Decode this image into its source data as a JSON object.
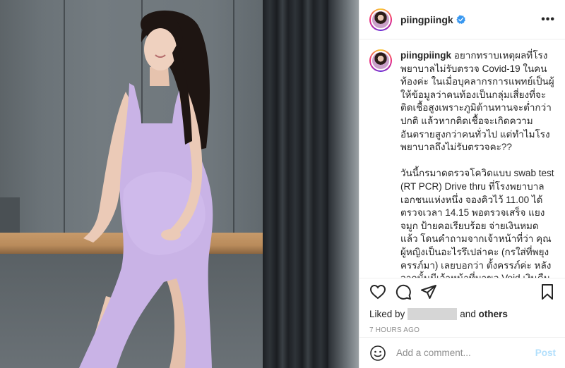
{
  "post": {
    "username": "piingpiingk",
    "more_icon": "more-horizontal-icon",
    "verified_icon": "verified-badge-icon",
    "caption": "อยากทราบเหตุผลที่โรงพยาบาลไม่รับตรวจ Covid-19 ในคนท้องค่ะ ในเมื่อบุคลากรการแพทย์เป็นผู้ให้ข้อมูลว่าคนท้องเป็นกลุ่มเสี่ยงที่จะติดเชื้อสูงเพราะภูมิต้านทานจะต่ำกว่าปกติ แล้วหากติดเชื้อจะเกิดความอันตรายสูงกว่าคนทั่วไป แต่ทำไมโรงพยาบาลถึงไม่รับตรวจคะ??\n\nวันนี้กรมาดตรวจโควิดแบบ swab test (RT PCR) Drive thru ที่โรงพยาบาลเอกชนแห่งหนึ่ง จองคิวไว้ 11.00 ได้ตรวจเวลา 14.15 พอตรวจเสร็จ แยงจมูก ป้ายคอเรียบร้อย จ่ายเงินหมดแล้ว โดนคำถามจากเจ้าหน้าที่ว่า คุณผู้หญิงเป็นอะไรรึเปล่าคะ (กรใส่ที่พยุงครรภ์มา) เลยบอกว่า ตั้งครรภ์ค่ะ หลังจากนั้นมีเจ้าหน้าที่มาขอ Void เงินคืน บอกว่า \"ต้องขออภัยด้วยค่ะ ทางโรงพยาบาลไม่รับตรวจโควิดให้คนตั้งครรภ์ค่ะ\""
  },
  "actions": {
    "like_icon": "heart-icon",
    "comment_icon": "comment-icon",
    "share_icon": "paper-plane-icon",
    "save_icon": "bookmark-icon"
  },
  "likes": {
    "prefix": "Liked by",
    "suffix": "and",
    "others": "others"
  },
  "timestamp": "7 HOURS AGO",
  "comment_box": {
    "emoji_icon": "smiley-icon",
    "placeholder": "Add a comment...",
    "post_label": "Post"
  },
  "colors": {
    "verified_blue": "#3897f0",
    "post_disabled": "#b2dffc",
    "dress_lavender": "#c9b3e6"
  }
}
